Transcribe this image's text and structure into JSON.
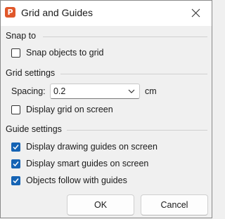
{
  "window": {
    "title": "Grid and Guides",
    "app_icon_letter": "P",
    "accent_color": "#e0572a"
  },
  "snap_to": {
    "header": "Snap to",
    "snap_objects_to_grid": {
      "label": "Snap objects to grid",
      "checked": false
    }
  },
  "grid_settings": {
    "header": "Grid settings",
    "spacing_label": "Spacing:",
    "spacing_value": "0.2",
    "spacing_unit": "cm",
    "display_grid": {
      "label": "Display grid on screen",
      "checked": false
    }
  },
  "guide_settings": {
    "header": "Guide settings",
    "display_drawing_guides": {
      "label": "Display drawing guides on screen",
      "checked": true
    },
    "display_smart_guides": {
      "label": "Display smart guides on screen",
      "checked": true
    },
    "objects_follow_guides": {
      "label": "Objects follow with guides",
      "checked": true
    }
  },
  "buttons": {
    "ok": "OK",
    "cancel": "Cancel"
  },
  "colors": {
    "checkbox_checked": "#1563b4",
    "dialog_bg": "#f0f0f0"
  }
}
